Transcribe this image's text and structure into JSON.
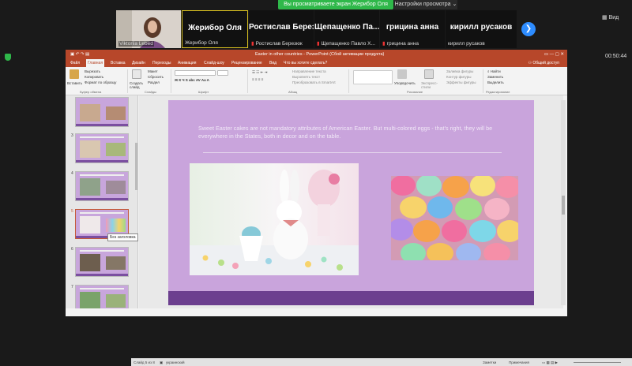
{
  "zoom": {
    "share_banner": "Вы просматриваете экран Жерибор Оля",
    "view_options": "Настройки просмотра ⌄",
    "view_button": "Вид",
    "timer": "00:50:44",
    "participants": [
      {
        "big": "",
        "small": "Viktoriia Lebed",
        "mic": false
      },
      {
        "big": "Жерибор Оля",
        "small": "Жерибор Оля",
        "mic": false
      },
      {
        "big": "Ростислав Берез...",
        "small": "Ростислав Березюк",
        "mic": true
      },
      {
        "big": "Щепащенко Па...",
        "small": "Щепащенко Павло Х...",
        "mic": true
      },
      {
        "big": "грицина анна",
        "small": "грицина анна",
        "mic": true
      },
      {
        "big": "кирилл русаков",
        "small": "кирилл русаков",
        "mic": false
      }
    ]
  },
  "ppt": {
    "window_title": "Easter in other countries - PowerPoint (Сбой активации продукта)",
    "tabs": [
      "Файл",
      "Главная",
      "Вставка",
      "Дизайн",
      "Переходы",
      "Анимация",
      "Слайд-шоу",
      "Рецензирование",
      "Вид",
      "Что вы хотите сделать?"
    ],
    "share": "Общий доступ",
    "ribbon": {
      "paste": "Вставить",
      "cut": "Вырезать",
      "copy": "Копировать",
      "format_painter": "Формат по образцу",
      "clipboard": "Буфер обмена",
      "new_slide": "Создать слайд",
      "layout": "Макет",
      "reset": "Сбросить",
      "section": "Раздел",
      "slides": "Слайды",
      "font": "Шрифт",
      "text_direction": "Направление текста",
      "align_text": "Выровнять текст",
      "smartart": "Преобразовать в SmartArt",
      "paragraph": "Абзац",
      "arrange": "Упорядочить",
      "quick_styles": "Экспресс-стили",
      "shape_fill": "Заливка фигуры",
      "shape_outline": "Контур фигуры",
      "shape_effects": "Эффекты фигуры",
      "drawing": "Рисование",
      "find": "Найти",
      "replace": "Заменить",
      "select": "Выделить",
      "editing": "Редактирование"
    },
    "slide_numbers": [
      "3",
      "4",
      "5",
      "6",
      "7"
    ],
    "tooltip": "Без заголовка",
    "slide_text": "Sweet Easter cakes are not mandatory attributes of American Easter. But multi-colored eggs - that's right, they will be everywhere in the States, both in decor and on the table.",
    "status": {
      "slide_of": "Слайд 5 из 8",
      "language": "украинский",
      "notes": "Заметки",
      "comments": "Примечания"
    }
  }
}
